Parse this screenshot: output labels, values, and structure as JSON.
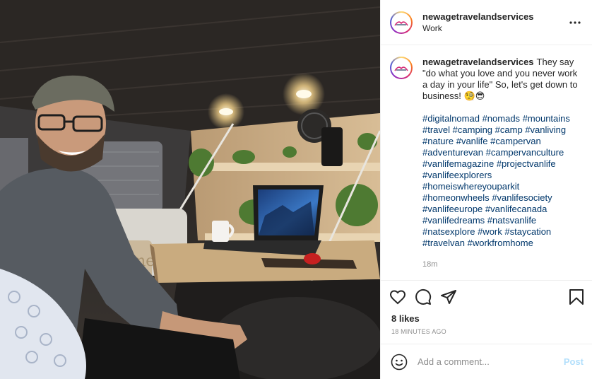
{
  "post": {
    "username": "newagetravelandservices",
    "location": "Work",
    "caption": "They say \"do what you love and you never work a day in your life\" So, let's get down to business! 🧐😎",
    "hashtags": [
      "#digitalnomad",
      "#nomads",
      "#mountains",
      "#travel",
      "#camping",
      "#camp",
      "#vanliving",
      "#nature",
      "#vanlife",
      "#campervan",
      "#adventurevan",
      "#campervanculture",
      "#vanlifemagazine",
      "#projectvanlife",
      "#vanlifeexplorers",
      "#homeiswhereyouparkit",
      "#homeonwheels",
      "#vanlifesociety",
      "#vanlifeeurope",
      "#vanlifecanada",
      "#vanlifedreams",
      "#natsvanlife",
      "#natsexplore",
      "#work",
      "#staycation",
      "#travelvan",
      "#workfromhome"
    ],
    "caption_age": "18m",
    "likes": "8 likes",
    "time_ago": "18 MINUTES AGO",
    "photo_label": "Man working on a laptop at a fold-down table inside a camper van",
    "pillow_text": "home"
  },
  "comment": {
    "placeholder": "Add a comment...",
    "post_label": "Post"
  },
  "icons": {
    "more": "more-options-icon",
    "like": "heart-icon",
    "comment": "comment-icon",
    "share": "share-icon",
    "save": "bookmark-icon",
    "emoji": "emoji-icon"
  },
  "colors": {
    "link": "#00376b",
    "muted": "#8e8e8e",
    "post_button": "#b2dffc"
  }
}
